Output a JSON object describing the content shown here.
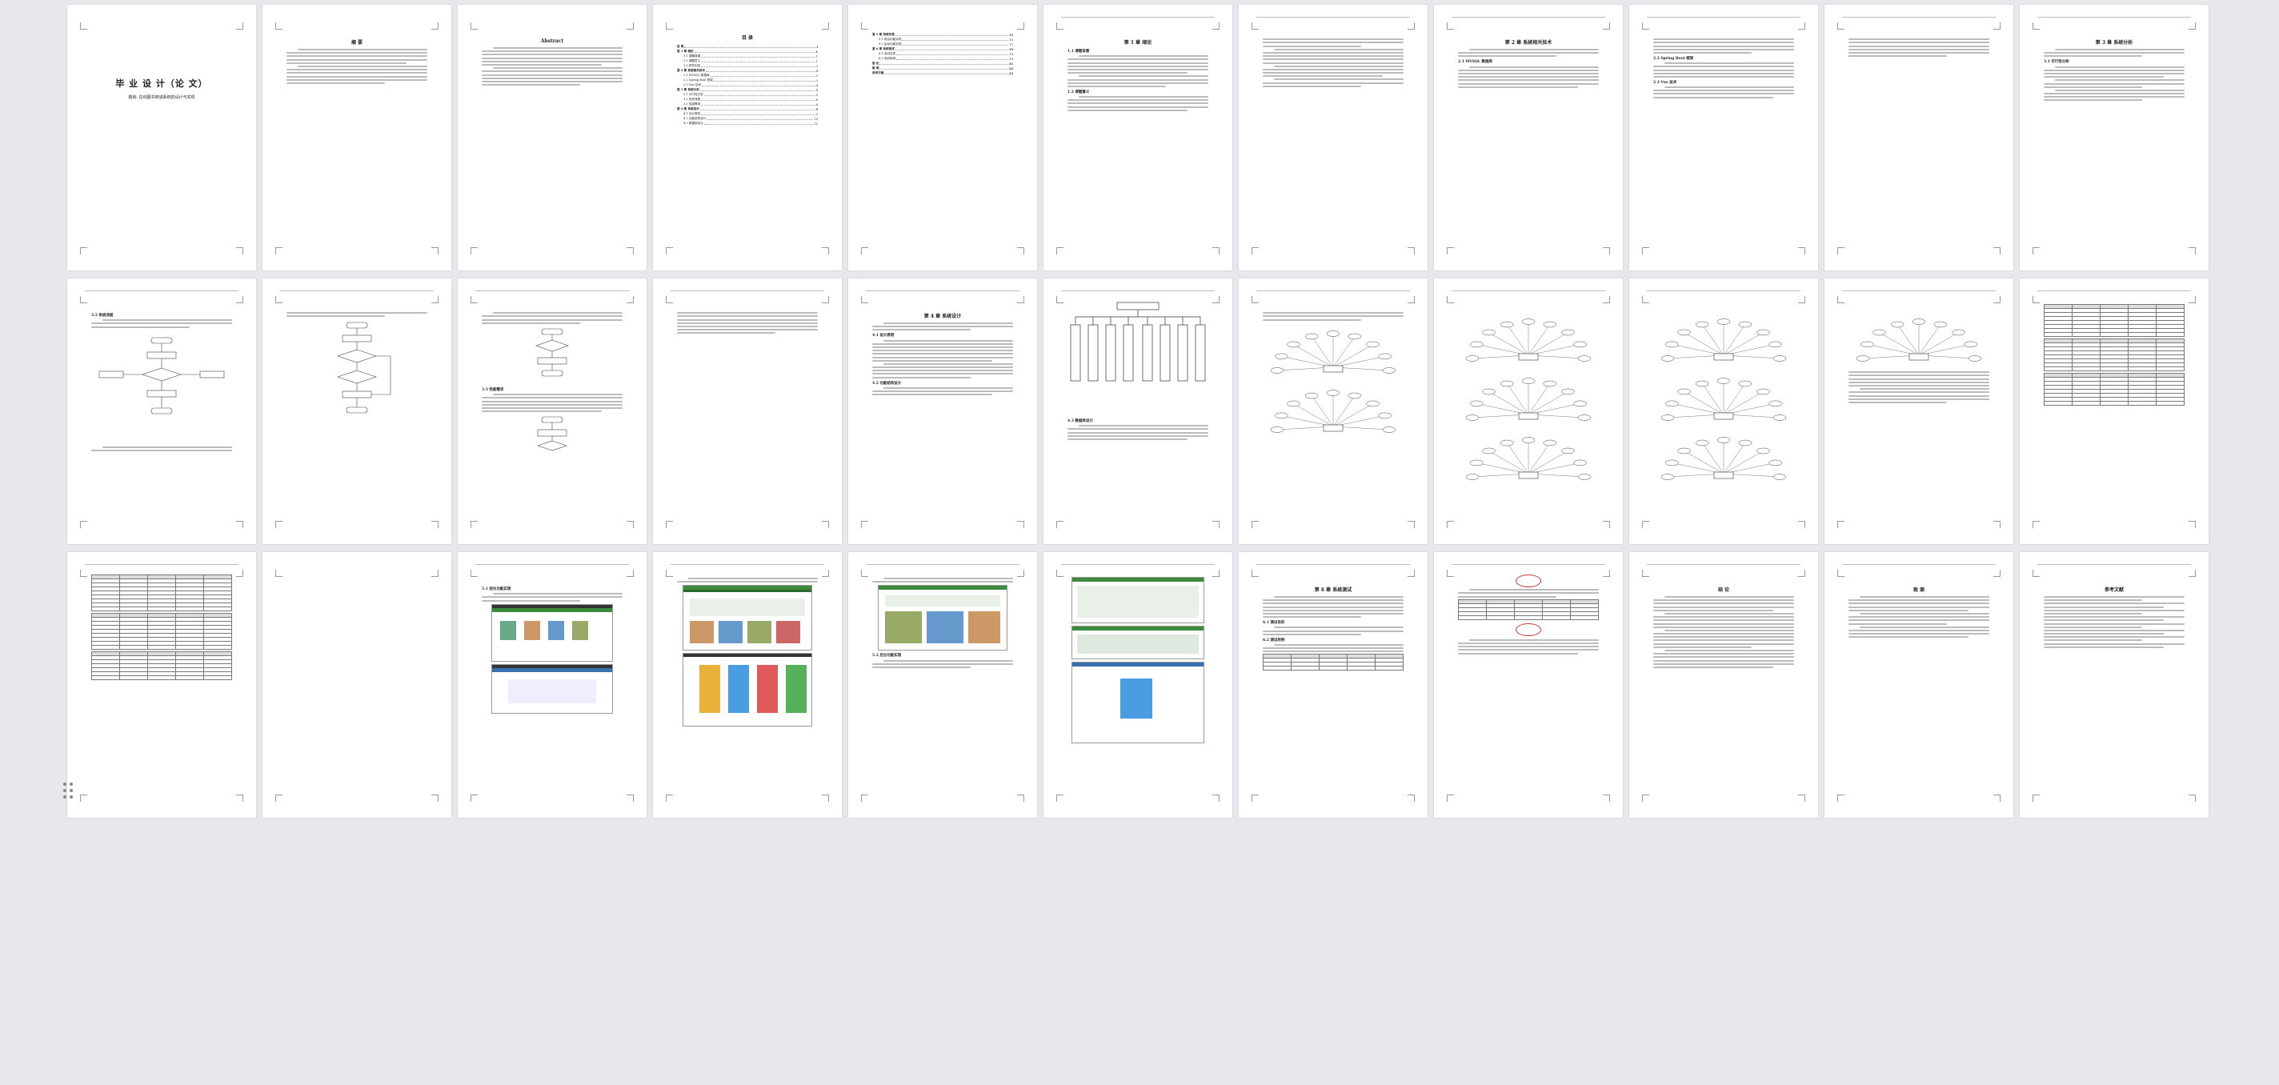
{
  "document": {
    "cover_title": "毕 业 设 计（论 文）",
    "cover_topic": "题目: 在线图书商城系统的设计与实现",
    "abstract_cn_heading": "摘  要",
    "abstract_en_heading": "Abstract",
    "toc_heading": "目  录",
    "toc": [
      {
        "label": "目  录",
        "page": "I",
        "level": 1
      },
      {
        "label": "第 1 章  绪论",
        "page": "1",
        "level": 1
      },
      {
        "label": "1.1 课题背景",
        "page": "1",
        "level": 2
      },
      {
        "label": "1.2 课题意义",
        "page": "1",
        "level": 2
      },
      {
        "label": "1.3 研究内容",
        "page": "2",
        "level": 2
      },
      {
        "label": "第 2 章  系统相关技术",
        "page": "3",
        "level": 1
      },
      {
        "label": "2.1 MYSQL 数据库",
        "page": "3",
        "level": 2
      },
      {
        "label": "2.2 Spring Boot 框架",
        "page": "3",
        "level": 2
      },
      {
        "label": "2.3 Vue 技术",
        "page": "4",
        "level": 2
      },
      {
        "label": "第 3 章  系统分析",
        "page": "5",
        "level": 1
      },
      {
        "label": "3.1 可行性分析",
        "page": "5",
        "level": 2
      },
      {
        "label": "3.2 系统流程",
        "page": "6",
        "level": 2
      },
      {
        "label": "3.3 性能需求",
        "page": "8",
        "level": 2
      },
      {
        "label": "第 4 章  系统设计",
        "page": "9",
        "level": 1
      },
      {
        "label": "4.1 设计原则",
        "page": "9",
        "level": 2
      },
      {
        "label": "4.2 功能结构设计",
        "page": "10",
        "level": 2
      },
      {
        "label": "4.3 数据库设计",
        "page": "11",
        "level": 2
      },
      {
        "label": "第 5 章  系统实现",
        "page": "15",
        "level": 1
      },
      {
        "label": "5.1 前台功能实现",
        "page": "15",
        "level": 2
      },
      {
        "label": "5.2 后台功能实现",
        "page": "17",
        "level": 2
      },
      {
        "label": "第 6 章  系统测试",
        "page": "19",
        "level": 1
      },
      {
        "label": "6.1 测试目的",
        "page": "19",
        "level": 2
      },
      {
        "label": "6.2 测试用例",
        "page": "19",
        "level": 2
      },
      {
        "label": "结  论",
        "page": "21",
        "level": 1
      },
      {
        "label": "致  谢",
        "page": "22",
        "level": 1
      },
      {
        "label": "参考文献",
        "page": "23",
        "level": 1
      }
    ],
    "ch1": "第 1 章  绪论",
    "ch1_s1": "1.1 课题背景",
    "ch1_s2": "1.2 课题意义",
    "ch2": "第 2 章  系统相关技术",
    "ch2_s1": "2.1 MYSQL 数据库",
    "ch2_s2": "2.2 Spring Boot 框架",
    "ch2_s3": "2.3 Vue 技术",
    "ch3": "第 3 章  系统分析",
    "ch3_s1": "3.1 可行性分析",
    "ch3_s2": "3.2 系统流程",
    "ch3_s3": "3.3 性能需求",
    "ch4": "第 4 章  系统设计",
    "ch4_s1": "4.1 设计原则",
    "ch4_s2": "4.2 功能结构设计",
    "ch4_s3": "4.3 数据库设计",
    "ch5_s1": "5.1 前台功能实现",
    "ch5_s2": "5.2 后台功能实现",
    "ch6": "第 6 章  系统测试",
    "ch6_s1": "6.1 测试目的",
    "ch6_s2": "6.2 测试用例",
    "conclusion": "结  论",
    "thanks": "致  谢",
    "refs": "参考文献"
  },
  "colors": {
    "accent_green": "#3c8a3c",
    "page_bg": "#ffffff",
    "canvas_bg": "#e6e8ec"
  }
}
